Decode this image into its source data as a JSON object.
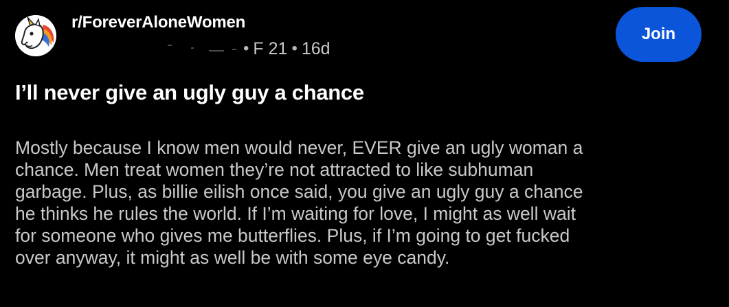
{
  "post": {
    "subreddit": "r/ForeverAloneWomen",
    "flair": "F 21",
    "separator": "•",
    "age": "16d",
    "join_label": "Join",
    "title": "I’ll never give an ugly guy a chance",
    "body_lines": [
      "Mostly because I know men would never, EVER give an ugly woman a",
      "chance. Men treat women they’re not attracted to like subhuman",
      "garbage. Plus, as billie eilish once said, you give an ugly guy a chance",
      "he thinks he rules the world. If I’m waiting for love, I might as well wait",
      "for someone who gives me butterflies. Plus, if I’m going to get fucked",
      "over anyway, it might as well be with some eye candy."
    ]
  },
  "theme": {
    "background": "#000000",
    "join_button_color": "#0a55d9",
    "body_text_color": "#c9c9c9"
  },
  "icons": {
    "avatar": "unicorn-avatar-icon"
  }
}
